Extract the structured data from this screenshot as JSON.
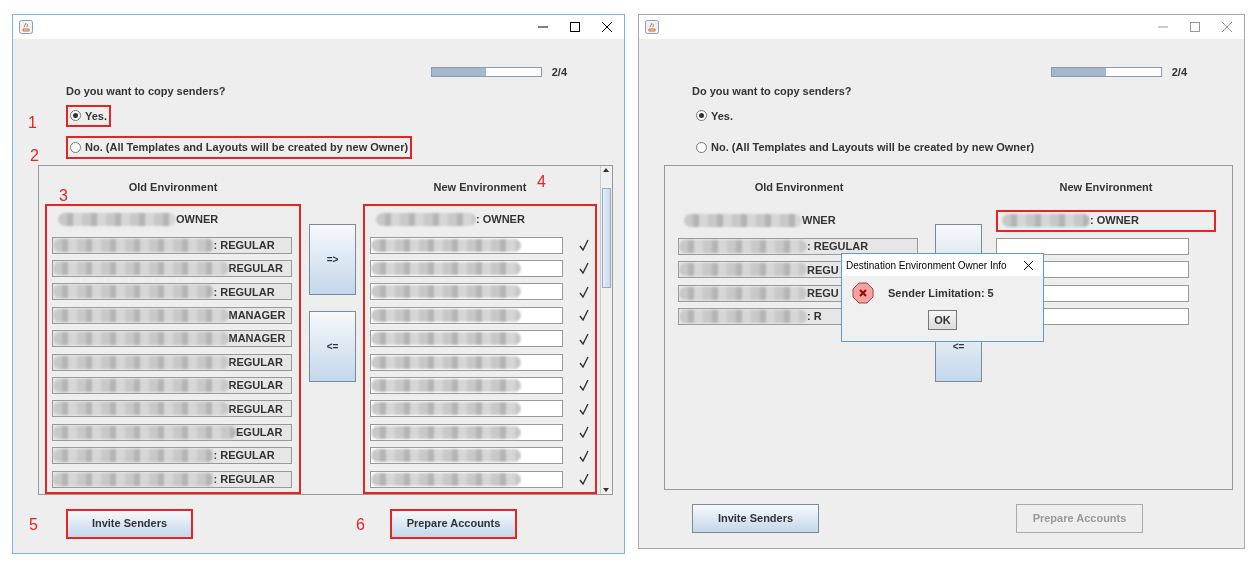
{
  "windows": [
    {
      "active": true,
      "progress": {
        "level": 0.5,
        "label": "2/4"
      },
      "question": "Do you want to copy senders?",
      "options": [
        {
          "label": "Yes.",
          "selected": true,
          "highlighted": true,
          "annotation": "1"
        },
        {
          "label": "No. (All Templates and Layouts will be created by new Owner)",
          "selected": false,
          "highlighted": true,
          "annotation": "2"
        }
      ],
      "pane": {
        "scrollable": true,
        "old_environment": {
          "heading": "Old Environment",
          "highlighted": true,
          "annotation": "3",
          "owner": {
            "text": "OWNER",
            "highlighted": false
          },
          "rows": [
            {
              "text": ": REGULAR"
            },
            {
              "text": "REGULAR"
            },
            {
              "text": ": REGULAR"
            },
            {
              "text": "MANAGER"
            },
            {
              "text": "MANAGER"
            },
            {
              "text": "REGULAR"
            },
            {
              "text": "REGULAR"
            },
            {
              "text": "REGULAR"
            },
            {
              "text": "EGULAR"
            },
            {
              "text": ": REGULAR"
            },
            {
              "text": ": REGULAR"
            }
          ]
        },
        "transfer_buttons": [
          {
            "label": "=>"
          },
          {
            "label": "<="
          }
        ],
        "new_environment": {
          "heading": "New Environment",
          "highlighted": true,
          "annotation": "4",
          "owner": {
            "text": ": OWNER",
            "highlighted": false
          },
          "rows": [
            {
              "redacted": true,
              "checked": true
            },
            {
              "redacted": true,
              "checked": true
            },
            {
              "redacted": true,
              "checked": true
            },
            {
              "redacted": true,
              "checked": true
            },
            {
              "redacted": true,
              "checked": true
            },
            {
              "redacted": true,
              "checked": true
            },
            {
              "redacted": true,
              "checked": true
            },
            {
              "redacted": true,
              "checked": true
            },
            {
              "redacted": true,
              "checked": true
            },
            {
              "redacted": true,
              "checked": true
            },
            {
              "redacted": true,
              "checked": true
            }
          ]
        }
      },
      "buttons": [
        {
          "label": "Invite Senders",
          "disabled": false,
          "highlighted": true,
          "annotation": "5"
        },
        {
          "label": "Prepare Accounts",
          "disabled": false,
          "highlighted": true,
          "annotation": "6"
        }
      ]
    },
    {
      "active": false,
      "progress": {
        "level": 0.5,
        "label": "2/4"
      },
      "question": "Do you want to copy senders?",
      "options": [
        {
          "label": "Yes.",
          "selected": true,
          "highlighted": false
        },
        {
          "label": "No. (All Templates and Layouts will be created by new Owner)",
          "selected": false,
          "highlighted": false
        }
      ],
      "pane": {
        "scrollable": false,
        "old_environment": {
          "heading": "Old Environment",
          "highlighted": false,
          "owner": {
            "text": "WNER",
            "highlighted": false
          },
          "rows": [
            {
              "text": ": REGULAR"
            },
            {
              "text": "REGU"
            },
            {
              "text": "REGU"
            },
            {
              "text": ": R"
            }
          ]
        },
        "transfer_buttons": [
          {
            "label": "<="
          }
        ],
        "new_environment": {
          "heading": "New Environment",
          "highlighted": false,
          "owner": {
            "text": ": OWNER",
            "highlighted": true
          },
          "rows": [
            {
              "redacted": false,
              "checked": false
            },
            {
              "redacted": false,
              "checked": false
            },
            {
              "redacted": false,
              "checked": false
            },
            {
              "redacted": false,
              "checked": false
            }
          ]
        }
      },
      "buttons": [
        {
          "label": "Invite Senders",
          "disabled": false,
          "highlighted": false
        },
        {
          "label": "Prepare Accounts",
          "disabled": true,
          "highlighted": false
        }
      ],
      "dialog": {
        "title": "Destination Environment Owner Info",
        "message": "Sender Limitation: 5",
        "button": "OK"
      }
    }
  ]
}
